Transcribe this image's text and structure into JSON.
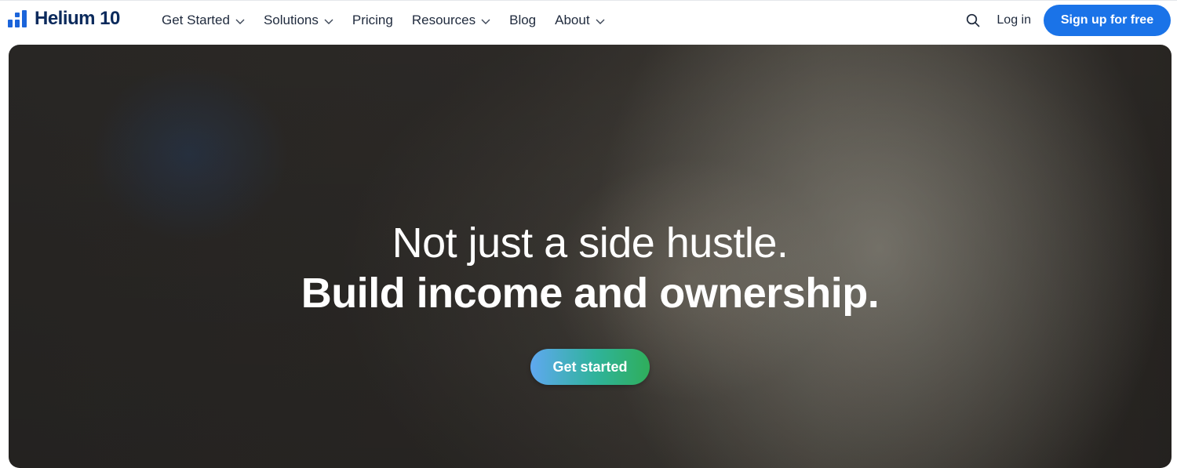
{
  "brand": {
    "name": "Helium 10",
    "color": "#1b64da",
    "text_color": "#0b2a5c"
  },
  "nav": {
    "items": [
      {
        "label": "Get Started",
        "dropdown": true
      },
      {
        "label": "Solutions",
        "dropdown": true
      },
      {
        "label": "Pricing",
        "dropdown": false
      },
      {
        "label": "Resources",
        "dropdown": true
      },
      {
        "label": "Blog",
        "dropdown": false
      },
      {
        "label": "About",
        "dropdown": true
      }
    ],
    "search_icon": "search-icon",
    "login_label": "Log in",
    "signup_label": "Sign up for free",
    "signup_color": "#1a73e8"
  },
  "hero": {
    "headline_line1": "Not just a side hustle.",
    "headline_line2": "Build income and ownership.",
    "cta_label": "Get started",
    "cta_gradient": [
      "#5fa8f0",
      "#2fb39a",
      "#2fae5b"
    ]
  }
}
